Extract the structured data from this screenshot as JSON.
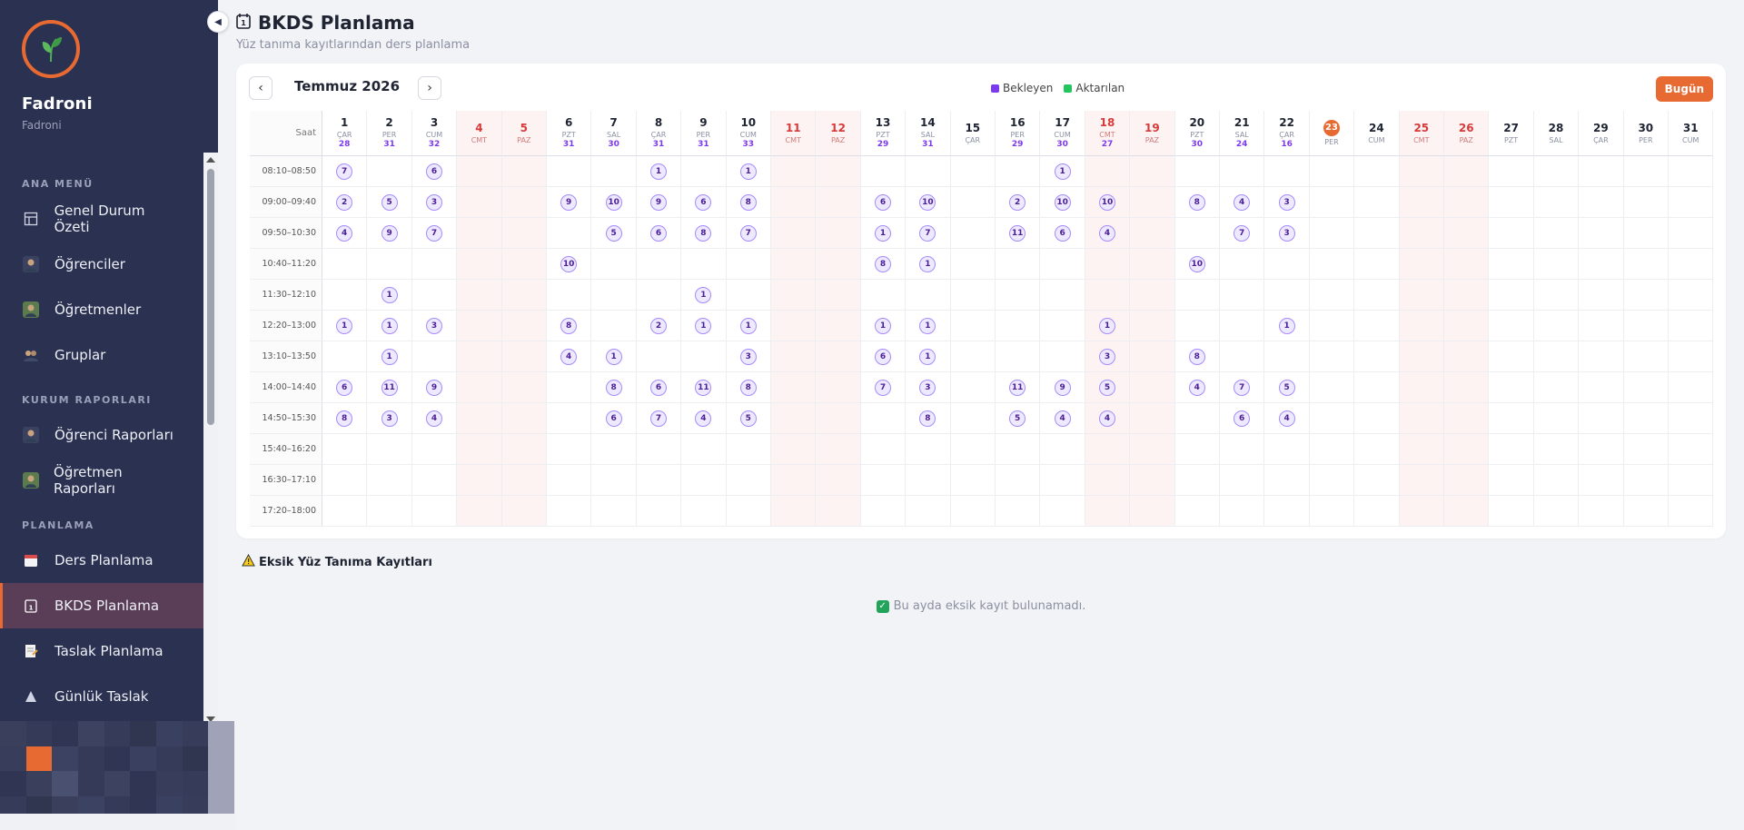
{
  "brand": {
    "name": "Fadroni",
    "subtitle": "Fadroni"
  },
  "sidebar": {
    "sections": [
      {
        "title": "ANA MENÜ",
        "items": [
          {
            "label": "Genel Durum Özeti",
            "icon": "grid-icon"
          },
          {
            "label": "Öğrenciler",
            "icon": "student-icon"
          },
          {
            "label": "Öğretmenler",
            "icon": "teacher-icon"
          },
          {
            "label": "Gruplar",
            "icon": "group-icon"
          }
        ]
      },
      {
        "title": "KURUM RAPORLARI",
        "items": [
          {
            "label": "Öğrenci Raporları",
            "icon": "student-report-icon"
          },
          {
            "label": "Öğretmen Raporları",
            "icon": "teacher-report-icon"
          }
        ]
      },
      {
        "title": "PLANLAMA",
        "items": [
          {
            "label": "Ders Planlama",
            "icon": "calendar-icon"
          },
          {
            "label": "BKDS Planlama",
            "icon": "calendar-day-icon",
            "active": true
          },
          {
            "label": "Taslak Planlama",
            "icon": "draft-icon"
          },
          {
            "label": "Günlük Taslak",
            "icon": "daily-draft-icon"
          }
        ]
      }
    ]
  },
  "page": {
    "title": "BKDS Planlama",
    "subtitle": "Yüz tanıma kayıtlarından ders planlama"
  },
  "calendar": {
    "prev": "‹",
    "next": "›",
    "month": "Temmuz 2026",
    "legend": [
      {
        "label": "Bekleyen",
        "color": "#7c3aed"
      },
      {
        "label": "Aktarılan",
        "color": "#22c55e"
      }
    ],
    "today_label": "Bugün",
    "time_header": "Saat",
    "days": [
      {
        "d": "1",
        "w": "ÇAR",
        "c": "28"
      },
      {
        "d": "2",
        "w": "PER",
        "c": "31"
      },
      {
        "d": "3",
        "w": "CUM",
        "c": "32"
      },
      {
        "d": "4",
        "w": "CMT",
        "c": "",
        "we": true
      },
      {
        "d": "5",
        "w": "PAZ",
        "c": "",
        "we": true
      },
      {
        "d": "6",
        "w": "PZT",
        "c": "31"
      },
      {
        "d": "7",
        "w": "SAL",
        "c": "30"
      },
      {
        "d": "8",
        "w": "ÇAR",
        "c": "31"
      },
      {
        "d": "9",
        "w": "PER",
        "c": "31"
      },
      {
        "d": "10",
        "w": "CUM",
        "c": "33"
      },
      {
        "d": "11",
        "w": "CMT",
        "c": "",
        "we": true
      },
      {
        "d": "12",
        "w": "PAZ",
        "c": "",
        "we": true
      },
      {
        "d": "13",
        "w": "PZT",
        "c": "29"
      },
      {
        "d": "14",
        "w": "SAL",
        "c": "31"
      },
      {
        "d": "15",
        "w": "ÇAR",
        "c": ""
      },
      {
        "d": "16",
        "w": "PER",
        "c": "29"
      },
      {
        "d": "17",
        "w": "CUM",
        "c": "30"
      },
      {
        "d": "18",
        "w": "CMT",
        "c": "27",
        "we": true
      },
      {
        "d": "19",
        "w": "PAZ",
        "c": "",
        "we": true
      },
      {
        "d": "20",
        "w": "PZT",
        "c": "30"
      },
      {
        "d": "21",
        "w": "SAL",
        "c": "24"
      },
      {
        "d": "22",
        "w": "ÇAR",
        "c": "16"
      },
      {
        "d": "23",
        "w": "PER",
        "c": "",
        "today": true
      },
      {
        "d": "24",
        "w": "CUM",
        "c": ""
      },
      {
        "d": "25",
        "w": "CMT",
        "c": "",
        "we": true
      },
      {
        "d": "26",
        "w": "PAZ",
        "c": "",
        "we": true
      },
      {
        "d": "27",
        "w": "PZT",
        "c": ""
      },
      {
        "d": "28",
        "w": "SAL",
        "c": ""
      },
      {
        "d": "29",
        "w": "ÇAR",
        "c": ""
      },
      {
        "d": "30",
        "w": "PER",
        "c": ""
      },
      {
        "d": "31",
        "w": "CUM",
        "c": ""
      }
    ],
    "times": [
      "08:10–08:50",
      "09:00–09:40",
      "09:50–10:30",
      "10:40–11:20",
      "11:30–12:10",
      "12:20–13:00",
      "13:10–13:50",
      "14:00–14:40",
      "14:50–15:30",
      "15:40–16:20",
      "16:30–17:10",
      "17:20–18:00"
    ],
    "cells": [
      [
        "7",
        "",
        "6",
        "",
        "",
        "",
        "",
        "1",
        "",
        "1",
        "",
        "",
        "",
        "",
        "",
        "",
        "1",
        "",
        "",
        "",
        "",
        "",
        "",
        "",
        "",
        "",
        "",
        "",
        "",
        "",
        ""
      ],
      [
        "2",
        "5",
        "3",
        "",
        "",
        "9",
        "10",
        "9",
        "6",
        "8",
        "",
        "",
        "6",
        "10",
        "",
        "2",
        "10",
        "10",
        "",
        "8",
        "4",
        "3",
        "",
        "",
        "",
        "",
        "",
        "",
        "",
        "",
        ""
      ],
      [
        "4",
        "9",
        "7",
        "",
        "",
        "",
        "5",
        "6",
        "8",
        "7",
        "",
        "",
        "1",
        "7",
        "",
        "11",
        "6",
        "4",
        "",
        "",
        "7",
        "3",
        "",
        "",
        "",
        "",
        "",
        "",
        "",
        "",
        ""
      ],
      [
        "",
        "",
        "",
        "",
        "",
        "10",
        "",
        "",
        "",
        "",
        "",
        "",
        "8",
        "1",
        "",
        "",
        "",
        "",
        "",
        "10",
        "",
        "",
        "",
        "",
        "",
        "",
        "",
        "",
        "",
        "",
        ""
      ],
      [
        "",
        "1",
        "",
        "",
        "",
        "",
        "",
        "",
        "1",
        "",
        "",
        "",
        "",
        "",
        "",
        "",
        "",
        "",
        "",
        "",
        "",
        "",
        "",
        "",
        "",
        "",
        "",
        "",
        "",
        "",
        ""
      ],
      [
        "1",
        "1",
        "3",
        "",
        "",
        "8",
        "",
        "2",
        "1",
        "1",
        "",
        "",
        "1",
        "1",
        "",
        "",
        "",
        "1",
        "",
        "",
        "",
        "1",
        "",
        "",
        "",
        "",
        "",
        "",
        "",
        "",
        ""
      ],
      [
        "",
        "1",
        "",
        "",
        "",
        "4",
        "1",
        "",
        "",
        "3",
        "",
        "",
        "6",
        "1",
        "",
        "",
        "",
        "3",
        "",
        "8",
        "",
        "",
        "",
        "",
        "",
        "",
        "",
        "",
        "",
        "",
        ""
      ],
      [
        "6",
        "11",
        "9",
        "",
        "",
        "",
        "8",
        "6",
        "11",
        "8",
        "",
        "",
        "7",
        "3",
        "",
        "11",
        "9",
        "5",
        "",
        "4",
        "7",
        "5",
        "",
        "",
        "",
        "",
        "",
        "",
        "",
        "",
        ""
      ],
      [
        "8",
        "3",
        "4",
        "",
        "",
        "",
        "6",
        "7",
        "4",
        "5",
        "",
        "",
        "",
        "8",
        "",
        "5",
        "4",
        "4",
        "",
        "",
        "6",
        "4",
        "",
        "",
        "",
        "",
        "",
        "",
        "",
        "",
        ""
      ],
      [
        "",
        "",
        "",
        "",
        "",
        "",
        "",
        "",
        "",
        "",
        "",
        "",
        "",
        "",
        "",
        "",
        "",
        "",
        "",
        "",
        "",
        "",
        "",
        "",
        "",
        "",
        "",
        "",
        "",
        "",
        ""
      ],
      [
        "",
        "",
        "",
        "",
        "",
        "",
        "",
        "",
        "",
        "",
        "",
        "",
        "",
        "",
        "",
        "",
        "",
        "",
        "",
        "",
        "",
        "",
        "",
        "",
        "",
        "",
        "",
        "",
        "",
        "",
        ""
      ],
      [
        "",
        "",
        "",
        "",
        "",
        "",
        "",
        "",
        "",
        "",
        "",
        "",
        "",
        "",
        "",
        "",
        "",
        "",
        "",
        "",
        "",
        "",
        "",
        "",
        "",
        "",
        "",
        "",
        "",
        "",
        ""
      ]
    ]
  },
  "missing": {
    "title": "Eksik Yüz Tanıma Kayıtları",
    "empty_text": "Bu ayda eksik kayıt bulunamadı."
  }
}
